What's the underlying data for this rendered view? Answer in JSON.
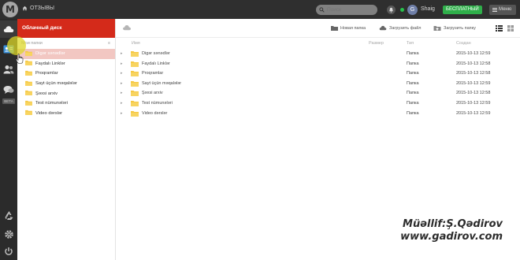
{
  "topbar": {
    "logo_letter": "M",
    "reviews_label": "ОТЗЫВЫ",
    "search_placeholder": "Поиск",
    "avatar_letter": "G",
    "username": "Shaig",
    "plan_badge": "БЕСПЛАТНЫЙ",
    "menu_label": "Меню"
  },
  "leftrail": {
    "items": [
      "cloud-icon",
      "contacts-card-icon",
      "people-icon",
      "chat-icon",
      "recycle-icon",
      "gear-icon",
      "power-icon"
    ],
    "beta_label": "BETA"
  },
  "sidebar": {
    "header": "Облачный диск",
    "section_label": "Мои папки",
    "section_marker": "≡",
    "folders": [
      {
        "label": "Digər sənədlər",
        "selected": true
      },
      {
        "label": "Faydalı Linklər",
        "selected": false
      },
      {
        "label": "Proqramlar",
        "selected": false
      },
      {
        "label": "Sayt üçün məqalələr",
        "selected": false
      },
      {
        "label": "Şəxsi arxiv",
        "selected": false
      },
      {
        "label": "Test nümunələri",
        "selected": false
      },
      {
        "label": "Video dərslər",
        "selected": false
      }
    ]
  },
  "toolbar": {
    "new_folder": "Новая папка",
    "upload_file": "Загрузить файл",
    "upload_folder": "Загрузить папку"
  },
  "table": {
    "columns": {
      "name": "Имя",
      "size": "Размер",
      "type": "Тип",
      "created": "Создан"
    },
    "rows": [
      {
        "name": "Digər sənədlər",
        "size": "",
        "type": "Папка",
        "created": "2015-10-13 12:59"
      },
      {
        "name": "Faydalı Linklər",
        "size": "",
        "type": "Папка",
        "created": "2015-10-13 12:58"
      },
      {
        "name": "Proqramlar",
        "size": "",
        "type": "Папка",
        "created": "2015-10-13 12:58"
      },
      {
        "name": "Sayt üçün məqalələr",
        "size": "",
        "type": "Папка",
        "created": "2015-10-13 12:59"
      },
      {
        "name": "Şəxsi arxiv",
        "size": "",
        "type": "Папка",
        "created": "2015-10-13 12:58"
      },
      {
        "name": "Test nümunələri",
        "size": "",
        "type": "Папка",
        "created": "2015-10-13 12:59"
      },
      {
        "name": "Video dərslər",
        "size": "",
        "type": "Папка",
        "created": "2015-10-13 12:59"
      }
    ]
  },
  "watermark": {
    "line1": "Müəllif:Ş.Qədirov",
    "line2": "www.gadirov.com"
  },
  "colors": {
    "topbar": "#2f2f2f",
    "sidebar_header": "#d42a1a",
    "selected_row": "#f2c7c2",
    "folder": "#f5c842",
    "badge_green": "#2faf4a"
  }
}
